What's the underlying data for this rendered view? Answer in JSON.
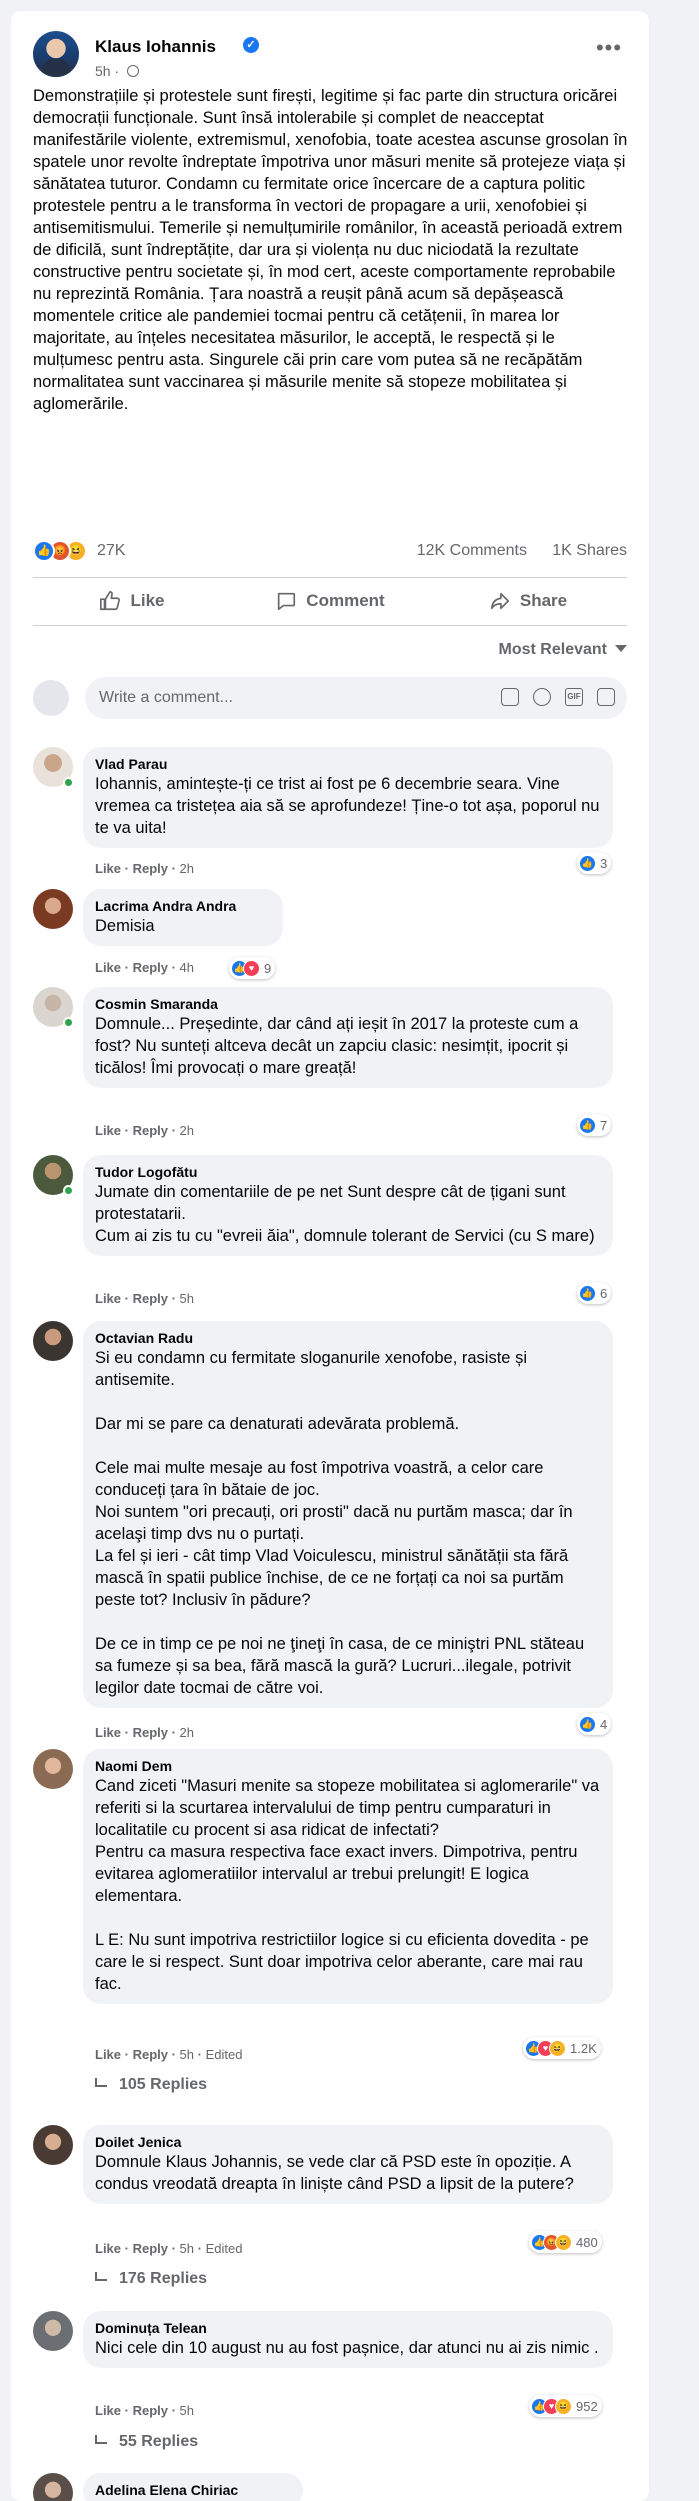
{
  "post": {
    "author": "Klaus Iohannis",
    "time": "5h",
    "text": "Demonstrațiile și protestele sunt firești, legitime și fac parte din structura oricărei democrații funcționale. Sunt însă intolerabile și complet de neacceptat manifestările violente, extremismul, xenofobia, toate acestea ascunse grosolan în spatele unor revolte îndreptate împotriva unor măsuri menite să protejeze viața și sănătatea tuturor. Condamn cu fermitate orice încercare de a captura politic protestele pentru a le transforma în vectori de propagare a urii, xenofobiei și antisemitismului. Temerile și nemulțumirile românilor, în această perioadă extrem de dificilă, sunt îndreptățite, dar ura și violența nu duc niciodată la rezultate constructive pentru societate și, în mod cert, aceste comportamente reprobabile nu reprezintă România. Țara noastră a reușit până acum să depășească momentele critice ale pandemiei tocmai pentru că cetățenii, în marea lor majoritate, au înțeles necesitatea măsurilor, le acceptă, le respectă și le mulțumesc pentru asta. Singurele căi prin care vom putea să ne recăpătăm normalitatea sunt vaccinarea și măsurile menite să stopeze mobilitatea și aglomerările.",
    "reaction_count": "27K",
    "comment_count": "12K Comments",
    "share_count": "1K Shares"
  },
  "actions": {
    "like": "Like",
    "comment": "Comment",
    "share": "Share"
  },
  "sort": {
    "label": "Most Relevant"
  },
  "composer": {
    "placeholder": "Write a comment..."
  },
  "comment_ui": {
    "like": "Like",
    "reply": "Reply",
    "sep": " · ",
    "edited": "Edited"
  },
  "comments": [
    {
      "name": "Vlad Parau",
      "text": "Iohannis, amintește-ți ce trist ai fost pe 6 decembrie seara. Vine vremea ca tristețea aia să se aprofundeze! Ține-o tot așa, poporul nu te va uita!",
      "time": "2h",
      "reactions": "3"
    },
    {
      "name": "Lacrima Andra Andra",
      "text": "Demisia",
      "time": "4h",
      "reactions": "9"
    },
    {
      "name": "Cosmin Smaranda",
      "text": "Domnule... Președinte, dar când ați ieșit în 2017 la proteste cum a fost? Nu sunteți altceva decât un zapciu clasic: nesimțit, ipocrit și ticălos! Îmi provocați o mare greață!",
      "time": "2h",
      "reactions": "7"
    },
    {
      "name": "Tudor Logofătu",
      "text": "Jumate din comentariile de pe net Sunt despre cât de țigani sunt protestatarii.\nCum ai zis tu cu \"evreii ăia\", domnule tolerant de Servici (cu S mare)",
      "time": "5h",
      "reactions": "6"
    },
    {
      "name": "Octavian Radu",
      "text": "Si eu condamn cu fermitate sloganurile xenofobe, rasiste și antisemite.\n\nDar mi se pare ca denaturati adevărata problemă.\n\nCele mai multe mesaje au fost împotriva voastră, a celor care conduceți țara în bătaie de joc.\nNoi suntem \"ori precauți, ori prosti\" dacă nu purtăm masca; dar în acelaşi timp dvs nu o purtați.\nLa fel și ieri - cât timp Vlad Voiculescu, ministrul sănătății sta fără mască în spatii publice închise, de ce ne forțați ca noi sa purtăm peste tot? Inclusiv în pădure?\n\nDe ce in timp ce pe noi ne ţineţi în casa, de ce miniştri PNL stăteau sa fumeze și sa bea, fără mască la gură? Lucruri...ilegale, potrivit legilor date tocmai de către voi.",
      "time": "2h",
      "reactions": "4"
    },
    {
      "name": "Naomi Dem",
      "text": "Cand ziceti \"Masuri menite sa stopeze mobilitatea si aglomerarile\" va referiti si la scurtarea intervalului de timp pentru cumparaturi in localitatile cu procent si asa ridicat de infectati?\nPentru ca masura respectiva face exact invers. Dimpotriva, pentru evitarea aglomeratiilor intervalul ar trebui prelungit! E logica elementara.\n\nL E: Nu sunt impotriva restrictiilor logice si cu eficienta dovedita - pe care le si respect. Sunt doar impotriva celor aberante, care mai rau fac.",
      "time": "5h",
      "edited": true,
      "reactions": "1.2K",
      "replies": "105 Replies"
    },
    {
      "name": "Doilet Jenica",
      "text": "Domnule Klaus Johannis, se vede clar că PSD este în opoziție. A condus vreodată dreapta în liniște când PSD a lipsit de la putere?",
      "time": "5h",
      "edited": true,
      "reactions": "480",
      "replies": "176 Replies"
    },
    {
      "name": "Dominuța Telean",
      "text": "Nici cele din 10 august nu au fost pașnice, dar atunci nu ai zis nimic .",
      "time": "5h",
      "reactions": "952",
      "replies": "55 Replies"
    },
    {
      "name": "Adelina Elena Chiriac"
    }
  ],
  "colors": {
    "accent": "#1877f2",
    "muted": "#65676b",
    "bubble": "#f0f2f5"
  }
}
